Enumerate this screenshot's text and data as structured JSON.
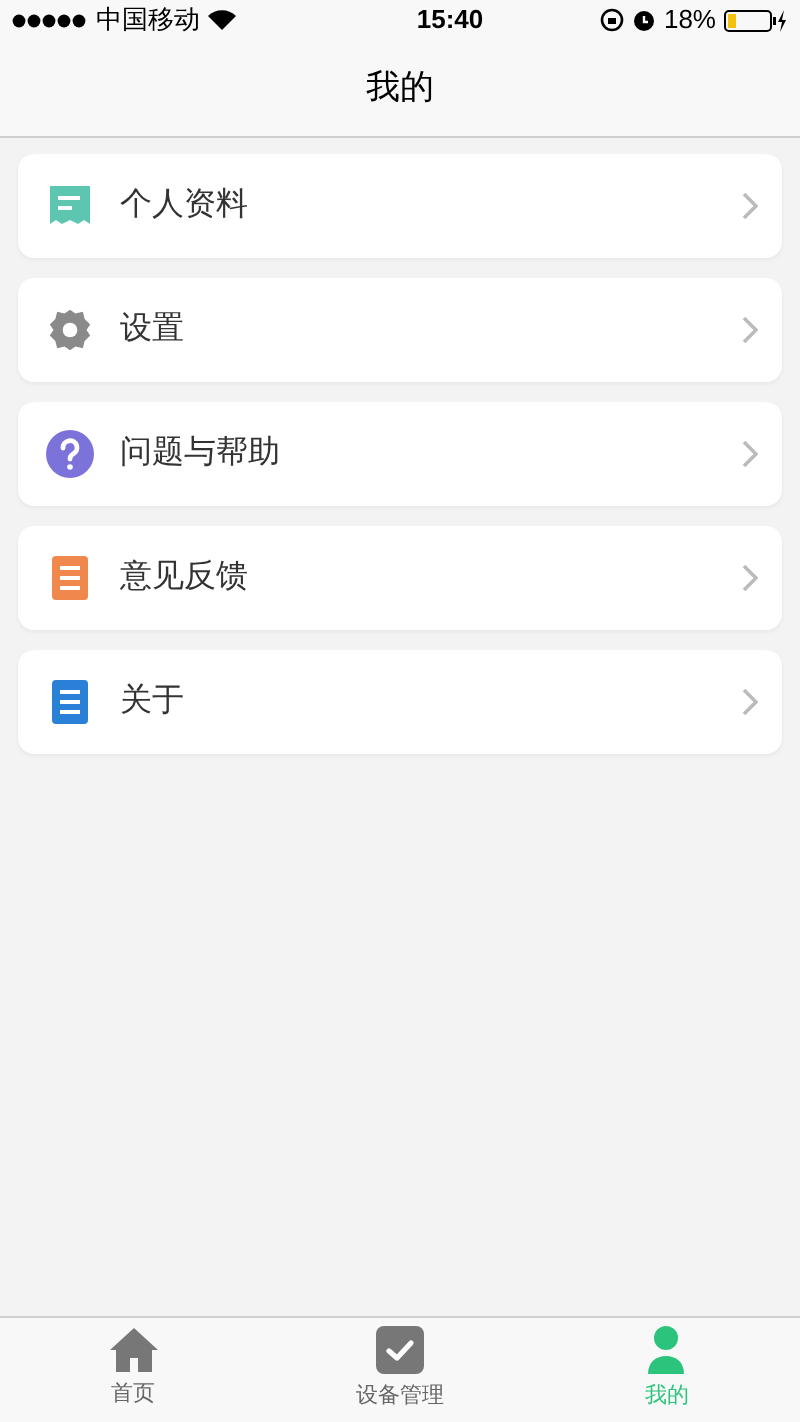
{
  "status_bar": {
    "carrier": "中国移动",
    "time": "15:40",
    "battery": "18%"
  },
  "title": "我的",
  "menu": [
    {
      "kind": "profile",
      "label": "个人资料"
    },
    {
      "kind": "settings",
      "label": "设置"
    },
    {
      "kind": "help",
      "label": "问题与帮助"
    },
    {
      "kind": "feedback",
      "label": "意见反馈"
    },
    {
      "kind": "about",
      "label": "关于"
    }
  ],
  "tabs": [
    {
      "kind": "home",
      "label": "首页",
      "selected": false
    },
    {
      "kind": "devices",
      "label": "设备管理",
      "selected": false
    },
    {
      "kind": "me",
      "label": "我的",
      "selected": true
    }
  ]
}
